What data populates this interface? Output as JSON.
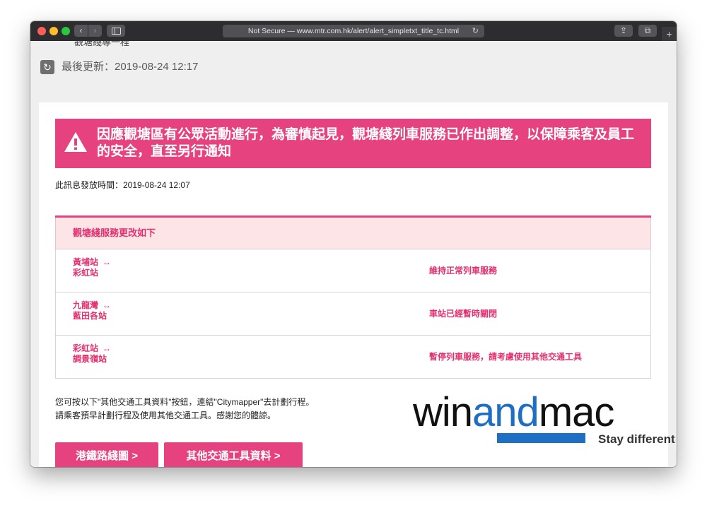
{
  "browser": {
    "address": "Not Secure — www.mtr.com.hk/alert/alert_simpletxt_title_tc.html",
    "back_glyph": "‹",
    "forward_glyph": "›",
    "reload_glyph": "↻",
    "share_glyph": "⇪",
    "tabs_glyph": "⧉",
    "newtab_glyph": "+"
  },
  "page": {
    "clipped_line": "觀塘綫專一程",
    "last_updated": "最後更新：2019-08-24 12:17",
    "alert_title": "因應觀塘區有公眾活動進行，為審慎起見，觀塘綫列車服務已作出調整，以保障乘客及員工的安全，直至另行通知",
    "issue_time": "此訊息發放時間：2019-08-24 12:07",
    "table_header": "觀塘綫服務更改如下",
    "rows": [
      {
        "from": "黃埔站",
        "arrow": "↔",
        "to": "彩虹站",
        "status": "維持正常列車服務"
      },
      {
        "from": "九龍灣",
        "arrow": "↔",
        "to": "藍田各站",
        "status": "車站已經暫時關閉"
      },
      {
        "from": "彩虹站",
        "arrow": "↔",
        "to": "調景嶺站",
        "status": "暫停列車服務，請考慮使用其他交通工具"
      }
    ],
    "instructions_line1": "您可按以下\"其他交通工具資料\"按鈕，連結\"Citymapper\"去計劃行程。",
    "instructions_line2": "請乘客預早計劃行程及使用其他交通工具。感謝您的體諒。",
    "btn_route_map": "港鐵路綫圖 >",
    "btn_other_transport": "其他交通工具資料 >",
    "refresh_glyph": "↻"
  },
  "watermark": {
    "part1": "win",
    "part2": "and",
    "part3": "mac",
    "tagline": "Stay different"
  },
  "colors": {
    "accent_pink": "#e6427f",
    "header_bg": "#fde4e6",
    "watermark_blue": "#1c6fc3"
  }
}
